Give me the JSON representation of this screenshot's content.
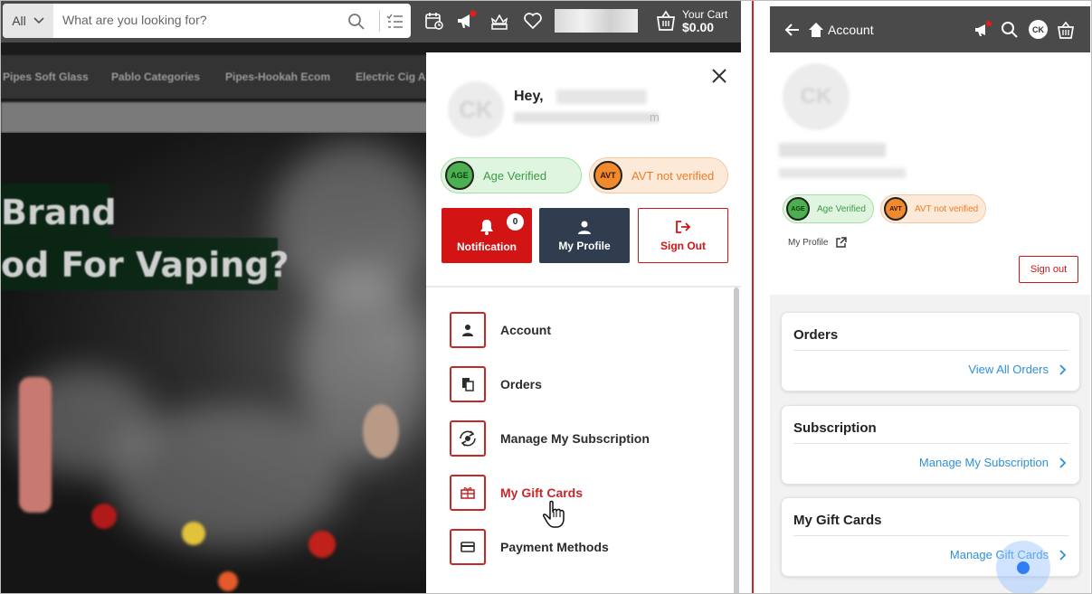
{
  "desktop": {
    "search": {
      "category": "All",
      "placeholder": "What are you looking for?"
    },
    "cart": {
      "label": "Your Cart",
      "total": "$0.00"
    },
    "categories": [
      "Pipes Soft Glass",
      "Pablo Categories",
      "Pipes-Hookah Ecom",
      "Electric Cig A"
    ],
    "hero": {
      "line1": "Brand",
      "line2": "od For Vaping?"
    },
    "drawer": {
      "greeting": "Hey,",
      "email_tail": "m",
      "avatar_initials": "CK",
      "badges": {
        "age": "Age Verified",
        "avt": "AVT not verified",
        "age_seal": "AGE",
        "avt_seal": "AVT"
      },
      "actions": {
        "notification": "Notification",
        "notification_count": "0",
        "profile": "My Profile",
        "signout": "Sign Out"
      },
      "menu": [
        {
          "label": "Account",
          "icon": "user-icon"
        },
        {
          "label": "Orders",
          "icon": "orders-icon"
        },
        {
          "label": "Manage My Subscription",
          "icon": "subscription-icon"
        },
        {
          "label": "My Gift Cards",
          "icon": "gift-card-icon"
        },
        {
          "label": "Payment Methods",
          "icon": "credit-card-icon"
        }
      ]
    }
  },
  "mobile": {
    "header_title": "Account",
    "avatar_initials": "CK",
    "header_avatar_initials": "CK",
    "badges": {
      "age": "Age Verified",
      "avt": "AVT not verified",
      "age_seal": "AGE",
      "avt_seal": "AVT"
    },
    "my_profile": "My Profile",
    "signout": "Sign out",
    "cards": [
      {
        "title": "Orders",
        "link": "View All Orders"
      },
      {
        "title": "Subscription",
        "link": "Manage My Subscription"
      },
      {
        "title": "My Gift Cards",
        "link": "Manage Gift Cards"
      }
    ]
  },
  "colors": {
    "accent_red": "#d31414",
    "navy": "#2f3d4e",
    "link_blue": "#2f8fd8",
    "header_gray": "#4a4a4a"
  }
}
